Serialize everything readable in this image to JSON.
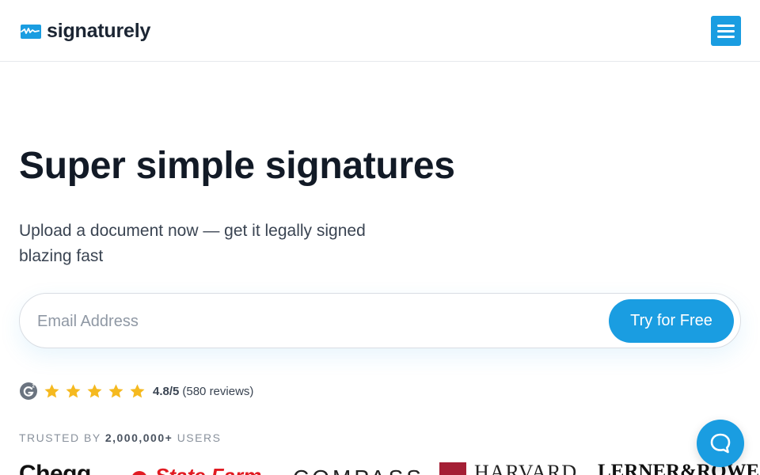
{
  "header": {
    "brand_name": "signaturely",
    "menu_icon": "hamburger-menu-icon"
  },
  "hero": {
    "title": "Super simple signatures",
    "subtitle": "Upload a document now — get it legally signed blazing fast"
  },
  "signup": {
    "email_placeholder": "Email Address",
    "email_value": "",
    "submit_label": "Try for Free"
  },
  "rating": {
    "platform_icon": "g2-icon",
    "stars": 5,
    "score": "4.8/5",
    "count": "(580 reviews)"
  },
  "trusted": {
    "prefix": "TRUSTED BY",
    "users": "2,000,000+",
    "suffix": "USERS"
  },
  "customer_logos": {
    "chegg": "Chegg",
    "statefarm": "State Farm",
    "compass": "COMPASS",
    "harvard": "HARVARD",
    "lerner": "LERNER&ROWE"
  },
  "colors": {
    "brand_blue": "#1a9de1",
    "star_yellow": "#f5b91f",
    "heading": "#121a26",
    "statefarm_red": "#e11b22",
    "harvard_crimson": "#a41f35"
  },
  "chat": {
    "icon": "chat-bubble-icon"
  }
}
